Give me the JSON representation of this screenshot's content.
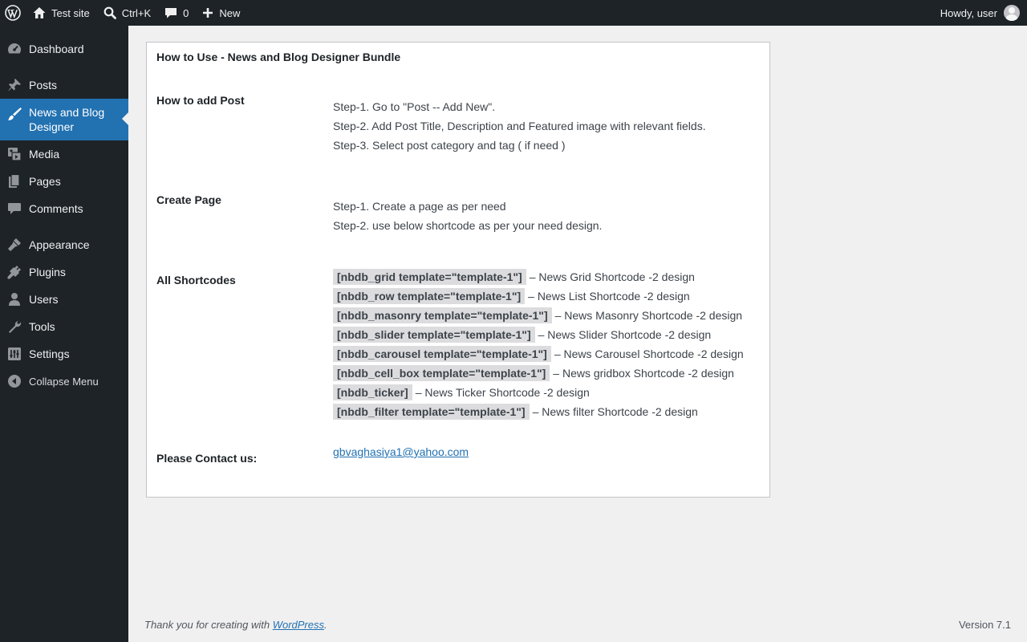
{
  "adminbar": {
    "site_name": "Test site",
    "search_shortcut": "Ctrl+K",
    "comments_count": "0",
    "new_label": "New",
    "howdy": "Howdy, user"
  },
  "sidebar": {
    "items": [
      {
        "label": "Dashboard",
        "icon": "dashboard-icon"
      },
      {
        "label": "Posts",
        "icon": "pin-icon"
      },
      {
        "label": "News and Blog Designer",
        "icon": "brush-icon"
      },
      {
        "label": "Media",
        "icon": "media-icon"
      },
      {
        "label": "Pages",
        "icon": "pages-icon"
      },
      {
        "label": "Comments",
        "icon": "comment-icon"
      },
      {
        "label": "Appearance",
        "icon": "appearance-icon"
      },
      {
        "label": "Plugins",
        "icon": "plugin-icon"
      },
      {
        "label": "Users",
        "icon": "user-icon"
      },
      {
        "label": "Tools",
        "icon": "wrench-icon"
      },
      {
        "label": "Settings",
        "icon": "settings-icon"
      },
      {
        "label": "Collapse Menu",
        "icon": "collapse-icon"
      }
    ]
  },
  "main": {
    "title": "How to Use - News and Blog Designer Bundle",
    "sections": {
      "add_post": {
        "label": "How to add Post",
        "steps": [
          "Step-1. Go to \"Post -- Add New\".",
          "Step-2. Add Post Title, Description and Featured image with relevant fields.",
          "Step-3. Select post category and tag ( if need )"
        ]
      },
      "create_page": {
        "label": "Create Page",
        "steps": [
          "Step-1. Create a page as per need",
          "Step-2. use below shortcode as per your need design."
        ]
      },
      "shortcodes": {
        "label": "All Shortcodes",
        "items": [
          {
            "code": "[nbdb_grid template=\"template-1\"]",
            "desc": "– News Grid Shortcode -2 design"
          },
          {
            "code": "[nbdb_row template=\"template-1\"]",
            "desc": "– News List Shortcode -2 design"
          },
          {
            "code": "[nbdb_masonry template=\"template-1\"]",
            "desc": "– News Masonry Shortcode -2 design"
          },
          {
            "code": "[nbdb_slider template=\"template-1\"]",
            "desc": "– News Slider Shortcode -2 design"
          },
          {
            "code": "[nbdb_carousel template=\"template-1\"]",
            "desc": "– News Carousel Shortcode -2 design"
          },
          {
            "code": "[nbdb_cell_box template=\"template-1\"]",
            "desc": "– News gridbox Shortcode -2 design"
          },
          {
            "code": "[nbdb_ticker]",
            "desc": "– News Ticker Shortcode -2 design"
          },
          {
            "code": "[nbdb_filter template=\"template-1\"]",
            "desc": "– News filter Shortcode -2 design"
          }
        ]
      },
      "contact": {
        "label": "Please Contact us:",
        "email": "gbvaghasiya1@yahoo.com"
      }
    }
  },
  "footer": {
    "thanks_prefix": "Thank you for creating with ",
    "wordpress_link": "WordPress",
    "thanks_suffix": ".",
    "version": "Version 7.1"
  },
  "colors": {
    "adminbar_bg": "#1d2327",
    "accent": "#2271b1",
    "content_bg": "#f0f0f1"
  }
}
